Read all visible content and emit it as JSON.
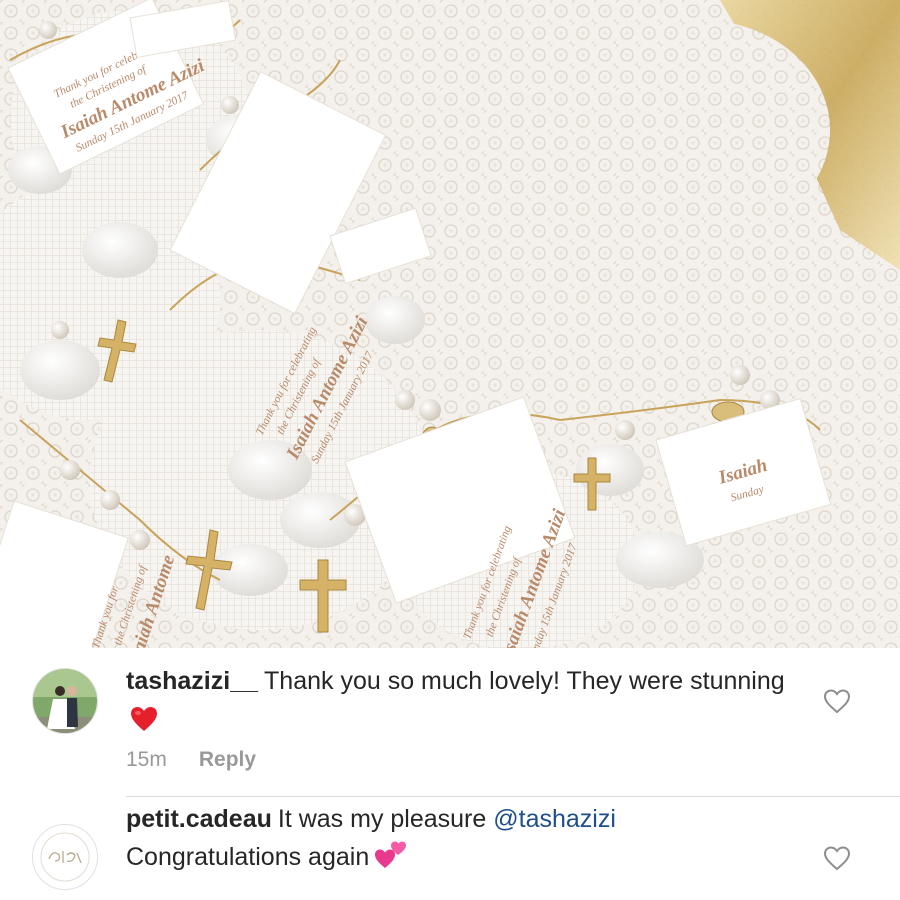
{
  "photo": {
    "tag_line1": "Thank you for celebrating",
    "tag_line2": "the Christening of",
    "tag_name": "Isaiah Antome Azizi",
    "tag_date": "Sunday 15th January 2017"
  },
  "comments": [
    {
      "username": "tashazizi__",
      "text": "Thank you so much lovely! They were stunning",
      "emoji": "red-heart",
      "time": "15m",
      "reply_label": "Reply",
      "avatar": "couple-wedding-photo"
    },
    {
      "username": "petit.cadeau",
      "text_before": "It was my pleasure",
      "mention": "@tashazizi",
      "text_after": "Congratulations again",
      "emoji": "two-hearts",
      "avatar_logo_text": "Petit Cadeau"
    }
  ],
  "colors": {
    "text": "#262626",
    "meta": "#999999",
    "mention": "#1f4f8a",
    "divider": "#dbdbdb",
    "tag_text": "#b88a6a"
  }
}
